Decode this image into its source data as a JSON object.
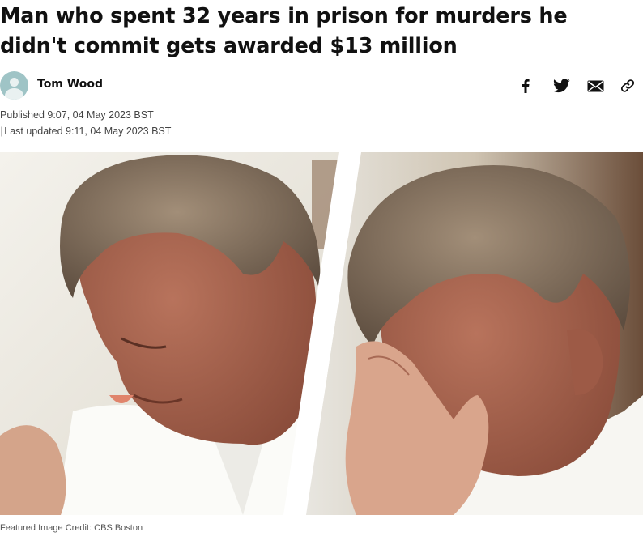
{
  "article": {
    "headline": "Man who spent 32 years in prison for murders he didn't commit gets awarded $13 million",
    "author": {
      "name": "Tom Wood"
    },
    "published": "Published 9:07, 04 May 2023 BST",
    "updated": "Last updated 9:11, 04 May 2023 BST",
    "image_credit": "Featured Image Credit: CBS Boston"
  },
  "share": {
    "icons": [
      "facebook-icon",
      "twitter-icon",
      "email-icon",
      "link-icon"
    ]
  },
  "colors": {
    "avatar_bg": "#9fc4c6",
    "text_primary": "#111111",
    "text_meta": "#444444"
  }
}
